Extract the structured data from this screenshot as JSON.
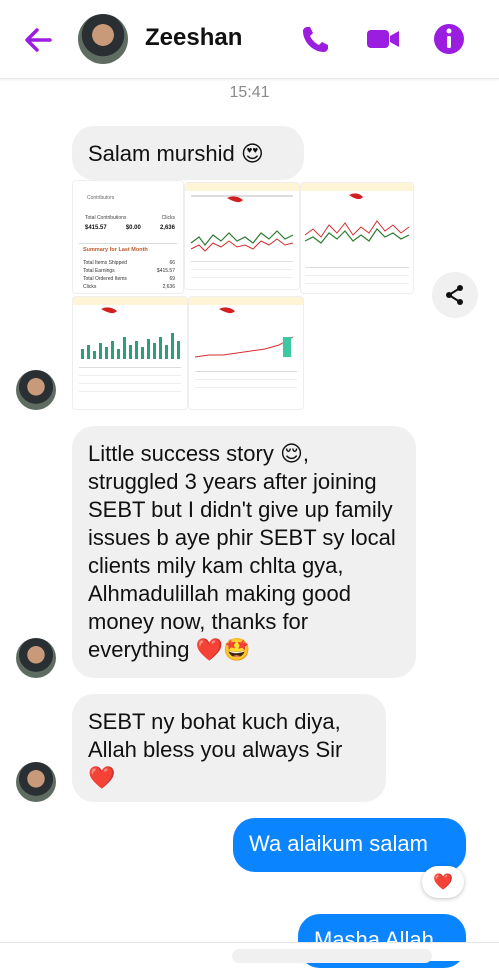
{
  "header": {
    "contact_name": "Zeeshan",
    "accent": "#9b1de0"
  },
  "timestamp": "15:41",
  "messages": [
    {
      "direction": "in",
      "text": "Salam murshid",
      "emoji": "😍"
    },
    {
      "direction": "in",
      "type": "images"
    },
    {
      "direction": "in",
      "text": "Little success story 😌, struggled 3 years after joining SEBT but I didn't give up family issues b aye phir SEBT sy local clients mily kam chlta gya, Alhmadulillah making good money now, thanks for everything ❤️🤩"
    },
    {
      "direction": "in",
      "text": "SEBT ny bohat kuch diya, Allah bless you always Sir ❤️"
    },
    {
      "direction": "out",
      "text": "Wa alaikum salam",
      "reaction": "❤️"
    },
    {
      "direction": "out",
      "text": "Masha Allah"
    }
  ],
  "colors": {
    "outgoing_bubble": "#0a84ff",
    "incoming_bubble": "#f0f0f0"
  },
  "thumbnail_1": {
    "contributors_label": "Contributors",
    "total_label": "Total Contributions",
    "total_value": "$415.57",
    "total_bounties_value": "$0.00",
    "clicks_label": "Clicks",
    "clicks_value": "2,636",
    "summary_title": "Summary for Last Month",
    "rows": [
      {
        "label": "Total Items Shipped",
        "value": "66"
      },
      {
        "label": "Total Earnings",
        "value": "$415.57"
      },
      {
        "label": "Total Ordered Items",
        "value": "69"
      },
      {
        "label": "Clicks",
        "value": "2,636"
      }
    ]
  }
}
